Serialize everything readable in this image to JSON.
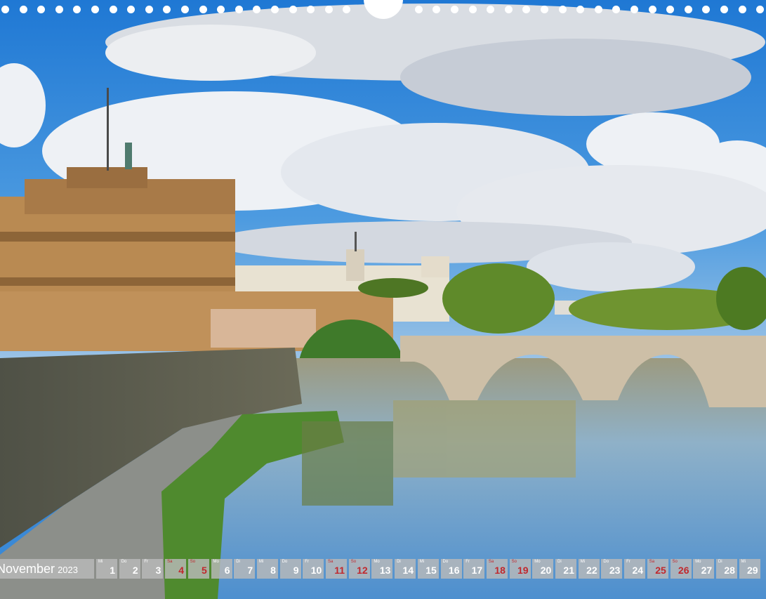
{
  "month": {
    "name": "November",
    "year": "2023"
  },
  "days": [
    {
      "abbr": "Mi",
      "num": "1",
      "weekend": false
    },
    {
      "abbr": "Do",
      "num": "2",
      "weekend": false
    },
    {
      "abbr": "Fr",
      "num": "3",
      "weekend": false
    },
    {
      "abbr": "Sa",
      "num": "4",
      "weekend": true
    },
    {
      "abbr": "So",
      "num": "5",
      "weekend": true
    },
    {
      "abbr": "Mo",
      "num": "6",
      "weekend": false
    },
    {
      "abbr": "Di",
      "num": "7",
      "weekend": false
    },
    {
      "abbr": "Mi",
      "num": "8",
      "weekend": false
    },
    {
      "abbr": "Do",
      "num": "9",
      "weekend": false
    },
    {
      "abbr": "Fr",
      "num": "10",
      "weekend": false
    },
    {
      "abbr": "Sa",
      "num": "11",
      "weekend": true
    },
    {
      "abbr": "So",
      "num": "12",
      "weekend": true
    },
    {
      "abbr": "Mo",
      "num": "13",
      "weekend": false
    },
    {
      "abbr": "Di",
      "num": "14",
      "weekend": false
    },
    {
      "abbr": "Mi",
      "num": "15",
      "weekend": false
    },
    {
      "abbr": "Do",
      "num": "16",
      "weekend": false
    },
    {
      "abbr": "Fr",
      "num": "17",
      "weekend": false
    },
    {
      "abbr": "Sa",
      "num": "18",
      "weekend": true
    },
    {
      "abbr": "So",
      "num": "19",
      "weekend": true
    },
    {
      "abbr": "Mo",
      "num": "20",
      "weekend": false
    },
    {
      "abbr": "Di",
      "num": "21",
      "weekend": false
    },
    {
      "abbr": "Mi",
      "num": "22",
      "weekend": false
    },
    {
      "abbr": "Do",
      "num": "23",
      "weekend": false
    },
    {
      "abbr": "Fr",
      "num": "24",
      "weekend": false
    },
    {
      "abbr": "Sa",
      "num": "25",
      "weekend": true
    },
    {
      "abbr": "So",
      "num": "26",
      "weekend": true
    },
    {
      "abbr": "Mo",
      "num": "27",
      "weekend": false
    },
    {
      "abbr": "Di",
      "num": "28",
      "weekend": false
    },
    {
      "abbr": "Mi",
      "num": "29",
      "weekend": false
    }
  ],
  "colors": {
    "weekday": "#ffffff",
    "weekend": "#c0282d",
    "cell_bg": "#b9b9b9",
    "sky": "#2f86d8",
    "water": "#8eb7d6"
  }
}
